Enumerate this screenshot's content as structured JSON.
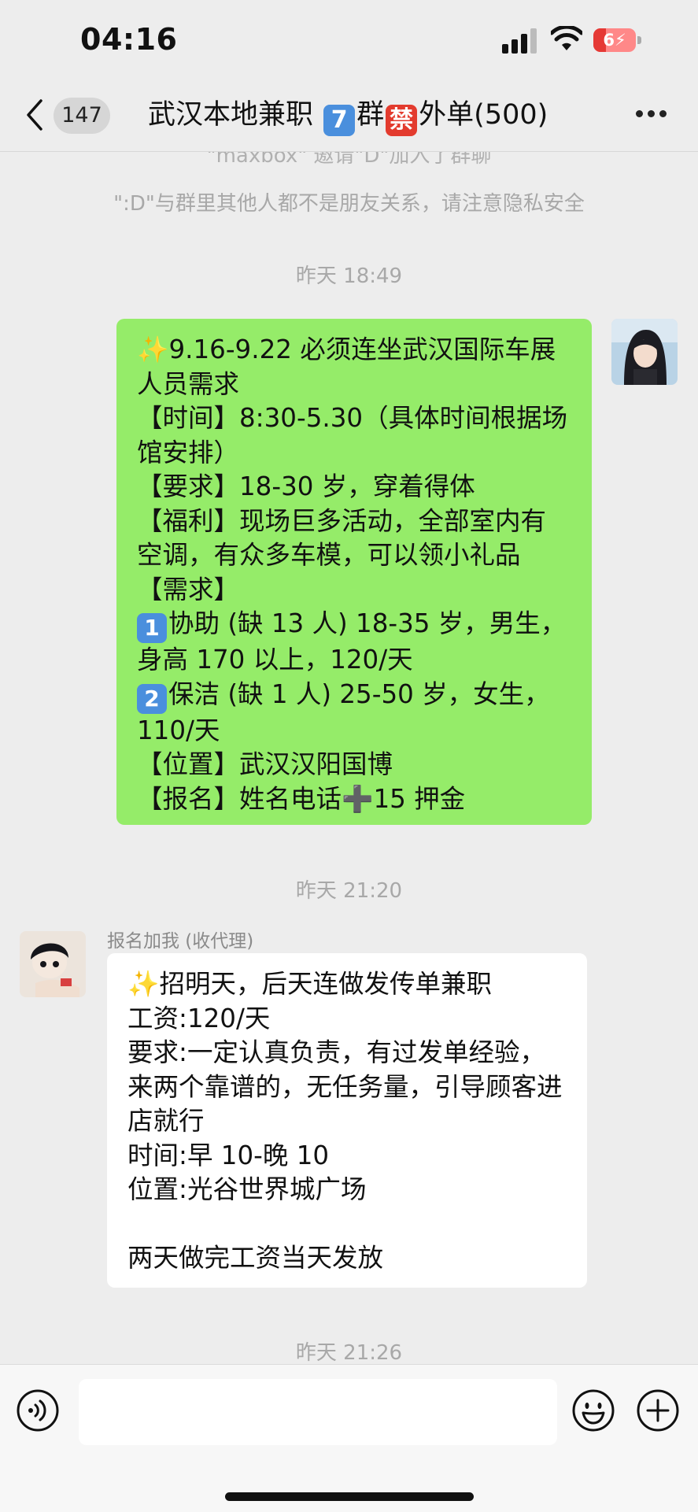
{
  "status_bar": {
    "time": "04:16",
    "battery": "6"
  },
  "nav": {
    "unread_count": "147",
    "title_part1": "武汉本地兼职",
    "title_emoji1": "7",
    "title_part2": "群",
    "title_emoji2": "禁",
    "title_part3": "外单(500)"
  },
  "chat": {
    "clipped_notice": "\"maxbox\" 邀请\"D\"加入了群聊",
    "system_notice": "\":D\"与群里其他人都不是朋友关系，请注意隐私安全",
    "messages": [
      {
        "timestamp": "昨天 18:49",
        "line1": "9.16-9.22 必须连坐武汉国际车展人员需求",
        "line2": "【时间】8:30-5.30（具体时间根据场馆安排）",
        "line3": "【要求】18-30 岁，穿着得体",
        "line4": "【福利】现场巨多活动，全部室内有空调，有众多车模，可以领小礼品",
        "line5": "【需求】",
        "item1_num": "1",
        "item1_text": "协助 (缺 13 人) 18-35 岁，男生，身高 170 以上，120/天",
        "item2_num": "2",
        "item2_text": "保洁 (缺 1 人) 25-50 岁，女生，110/天",
        "line6": "【位置】武汉汉阳国博",
        "line7_pre": "【报名】姓名电话",
        "line7_post": "15 押金"
      },
      {
        "timestamp": "昨天 21:20",
        "sender": "报名加我 (收代理)",
        "line1": "招明天，后天连做发传单兼职",
        "line2": "工资:120/天",
        "line3": "要求:一定认真负责，有过发单经验，来两个靠谱的，无任务量，引导顾客进店就行",
        "line4": "时间:早 10-晚 10",
        "line5": "位置:光谷世界城广场",
        "line6": "两天做完工资当天发放"
      },
      {
        "timestamp": "昨天 21:26"
      }
    ]
  },
  "icons": {
    "back": "chevron-left-icon",
    "more": "more-dots-icon",
    "voice": "voice-icon",
    "emoji": "smiley-icon",
    "plus": "plus-circle-icon",
    "sparkle": "sparkles-emoji",
    "heavy_plus": "heavy-plus-emoji"
  },
  "colors": {
    "bubble_self": "#95ec69",
    "bubble_other": "#ffffff",
    "background": "#ededed"
  }
}
